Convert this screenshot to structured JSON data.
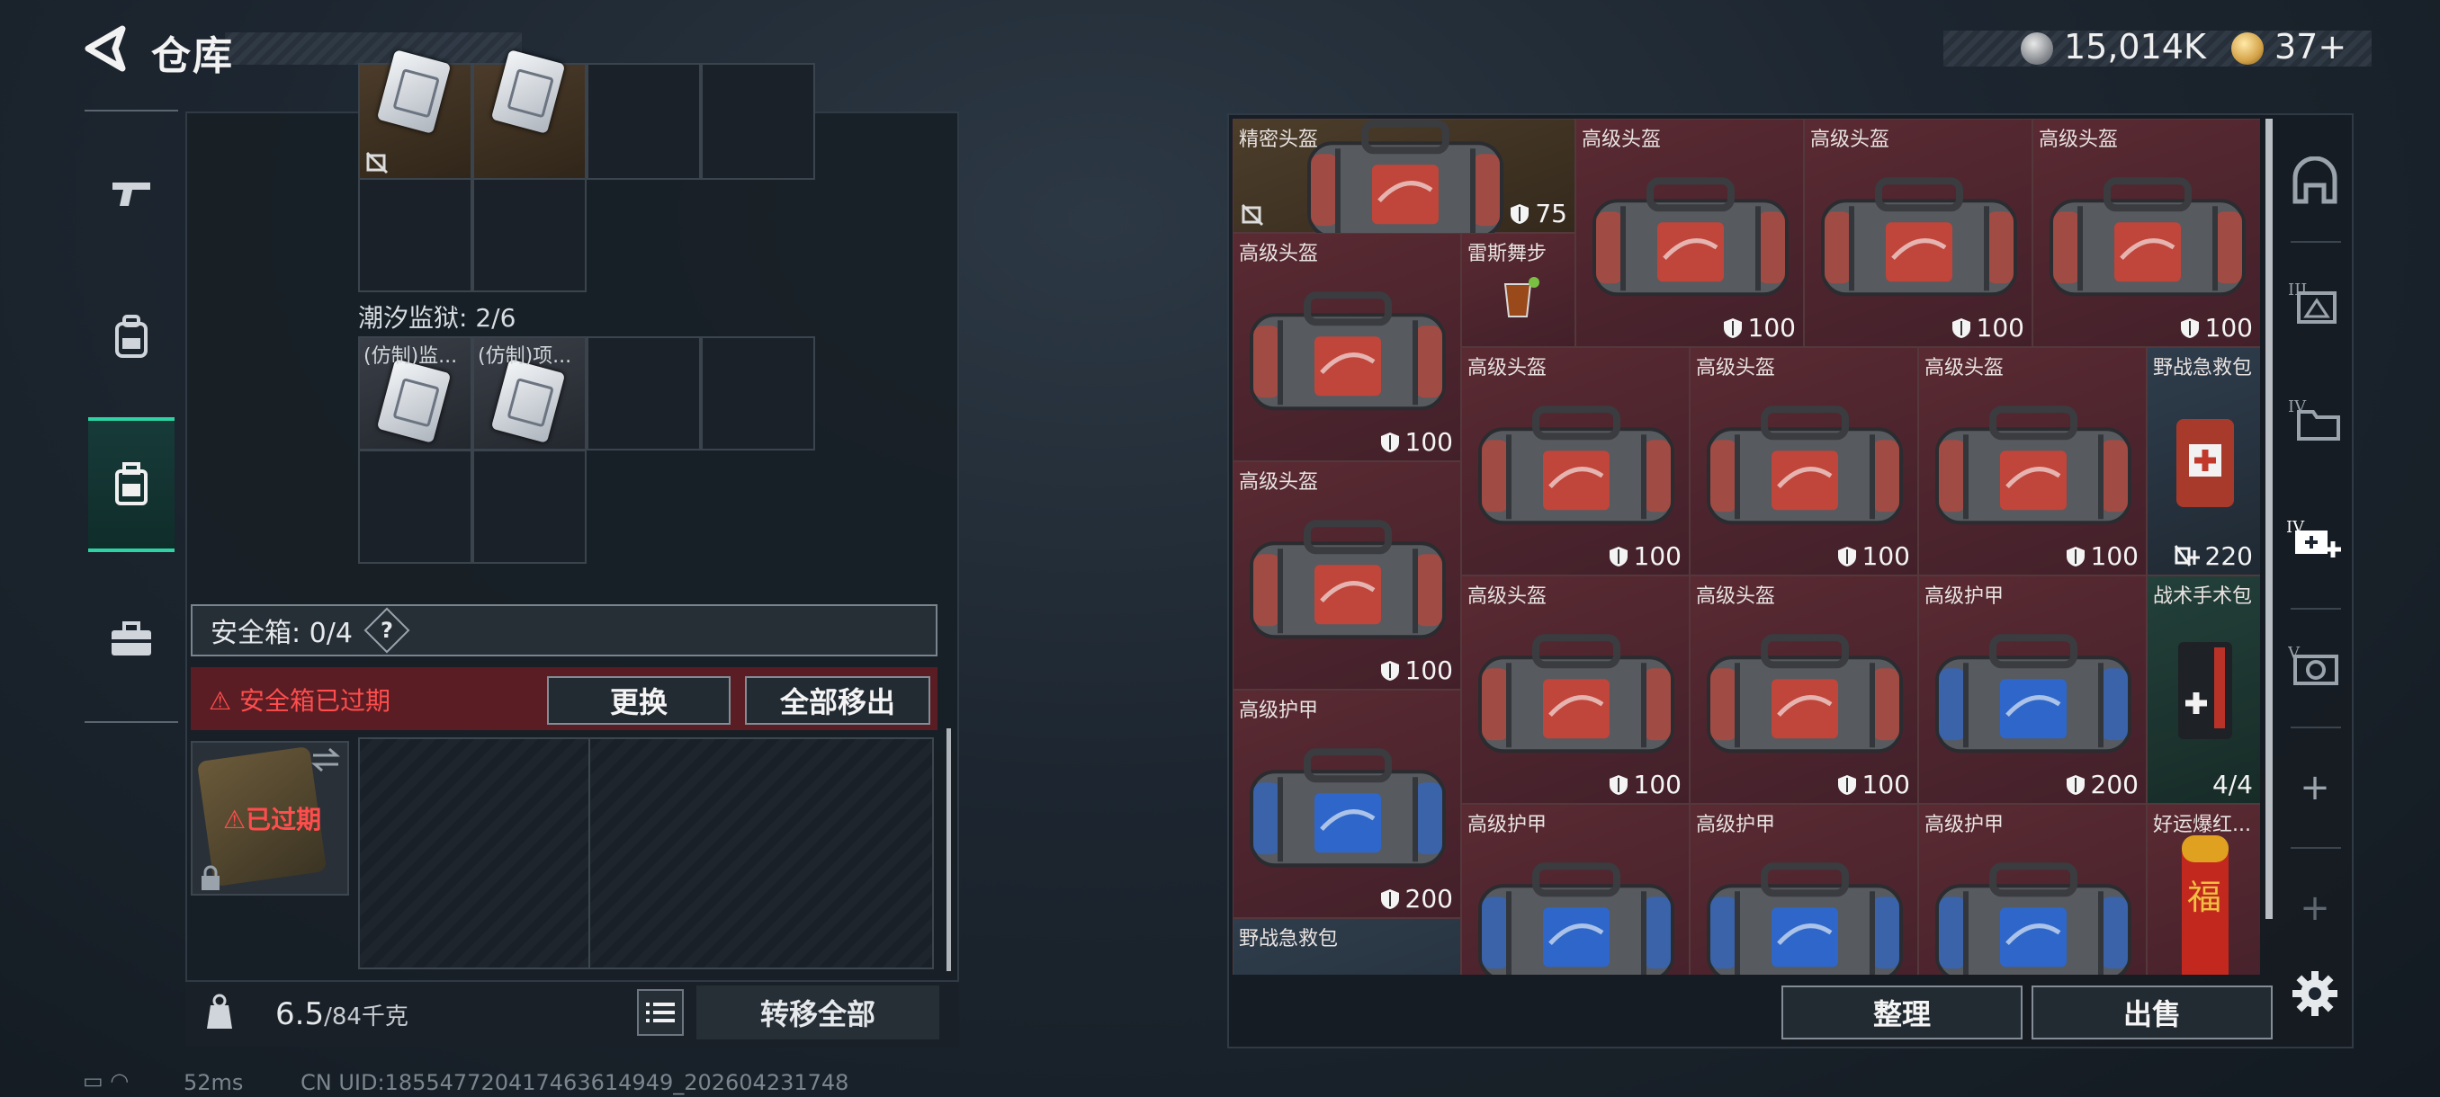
{
  "header": {
    "title": "仓库",
    "currency": [
      {
        "icon": "silver-coin-icon",
        "value": "15,014K"
      },
      {
        "icon": "gold-coin-icon",
        "value": "37+"
      }
    ]
  },
  "left_nav": [
    {
      "icon": "gun-icon"
    },
    {
      "icon": "backpack-icon"
    },
    {
      "icon": "case-icon",
      "active": true
    },
    {
      "icon": "toolbox-icon"
    }
  ],
  "container": {
    "top_cells": [],
    "tidal_prison": "潮汐监狱: 2/6",
    "tidal_items": [
      {
        "label": "(仿制)监..."
      },
      {
        "label": "(仿制)项..."
      }
    ],
    "safebox_label": "安全箱: 0/4",
    "help": "?",
    "expired_warning": "安全箱已过期",
    "replace_label": "更换",
    "move_all_label": "全部移出",
    "expired_badge": "已过期",
    "weight_current": "6.5",
    "weight_max": "/84千克",
    "transfer_all_label": "转移全部"
  },
  "status": {
    "ping": "52ms",
    "uid": "CN UID:1855477204174636149​49_202604231748"
  },
  "stash": {
    "items": [
      {
        "name": "精密头盔",
        "value": "75",
        "color": "gold",
        "bag": "red"
      },
      {
        "name": "高级头盔",
        "value": "100",
        "color": "red",
        "bag": "red"
      },
      {
        "name": "高级头盔",
        "value": "100",
        "color": "red",
        "bag": "red"
      },
      {
        "name": "高级头盔",
        "value": "100",
        "color": "red",
        "bag": "red"
      },
      {
        "name": "高级头盔",
        "value": "100",
        "color": "red",
        "bag": "red"
      },
      {
        "name": "雷斯舞步",
        "value": "",
        "color": "red",
        "bag": "drink"
      },
      {
        "name": "高级头盔",
        "value": "100",
        "color": "red",
        "bag": "red"
      },
      {
        "name": "高级头盔",
        "value": "100",
        "color": "red",
        "bag": "red"
      },
      {
        "name": "高级头盔",
        "value": "100",
        "color": "red",
        "bag": "red"
      },
      {
        "name": "野战急救包",
        "value": "220",
        "color": "blue",
        "bag": "medkit"
      },
      {
        "name": "高级头盔",
        "value": "100",
        "color": "red",
        "bag": "red"
      },
      {
        "name": "高级头盔",
        "value": "100",
        "color": "red",
        "bag": "red"
      },
      {
        "name": "高级头盔",
        "value": "100",
        "color": "red",
        "bag": "red"
      },
      {
        "name": "高级护甲",
        "value": "200",
        "color": "red",
        "bag": "blue"
      },
      {
        "name": "战术手术包",
        "value": "4/4",
        "color": "green",
        "bag": "surgery"
      },
      {
        "name": "高级护甲",
        "value": "200",
        "color": "red",
        "bag": "blue"
      },
      {
        "name": "高级护甲",
        "value": "",
        "color": "red",
        "bag": "blue"
      },
      {
        "name": "高级护甲",
        "value": "",
        "color": "red",
        "bag": "blue"
      },
      {
        "name": "高级护甲",
        "value": "",
        "color": "red",
        "bag": "blue"
      },
      {
        "name": "好运爆红...",
        "value": "",
        "color": "red",
        "bag": "firecracker"
      },
      {
        "name": "野战急救包",
        "value": "",
        "color": "blue",
        "bag": "medkit"
      }
    ],
    "sort_label": "整理",
    "sell_label": "出售"
  },
  "right_nav": [
    {
      "icon": "helmet-slot-icon"
    },
    {
      "icon": "tier3-armor-icon"
    },
    {
      "icon": "tier4-folder-icon"
    },
    {
      "icon": "tier4-medkit-add-icon"
    },
    {
      "icon": "tier5-camera-icon"
    },
    {
      "icon": "add-icon",
      "label": "+"
    },
    {
      "icon": "add-icon",
      "label": "+"
    }
  ]
}
